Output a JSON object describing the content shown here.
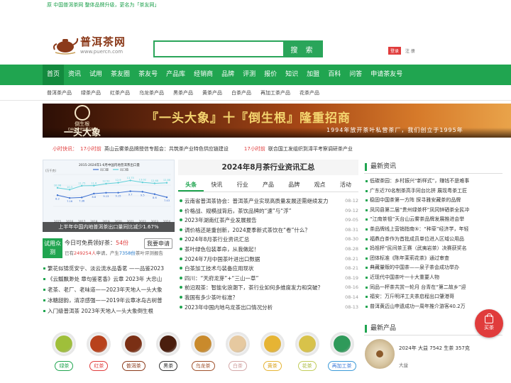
{
  "topbar": {
    "notice": "原 中国普洱茶网 整体品牌升级，更名为「茶友网」"
  },
  "logo": {
    "cn": "普洱茶网",
    "url": "www.puercn.com"
  },
  "search": {
    "placeholder": "",
    "button": "搜 索"
  },
  "user": {
    "login": "登录",
    "register": "注 册"
  },
  "mainnav": [
    "首页",
    "资讯",
    "试用",
    "茶友圈",
    "茶友号",
    "产品库",
    "经销商",
    "品牌",
    "评测",
    "报价",
    "知识",
    "加盟",
    "百科",
    "问答",
    "申请茶友号"
  ],
  "subnav": [
    "普洱茶产品",
    "绿茶产品",
    "红茶产品",
    "乌龙茶产品",
    "黑茶产品",
    "黄茶产品",
    "白茶产品",
    "再加工茶产品",
    "花茶产品"
  ],
  "banner": {
    "brand": "倒生根",
    "brand_en": "DAOSHENGGEN",
    "big": "一头大象",
    "title": "『一头大象』十『倒生根』隆重招商",
    "sub": "1994年放开茶叶私营茶厂，我们创立于1995年"
  },
  "ticker": [
    {
      "label": "小时快讯：",
      "time": "17小时前",
      "text": "英山云雾茶品牌授信专题会：共筑茶产业特色供应链建设"
    },
    {
      "label": "",
      "time": "17小时前",
      "text": "联合国工发组织到漳平考察调研茶产业"
    }
  ],
  "chart_data": {
    "type": "line",
    "title": "2015-2024年1-6月中国内地普洱茶出口量",
    "ylabel": "(万千克)",
    "legend": [
      "出口量",
      "出口值"
    ],
    "categories": [
      "2015",
      "2016",
      "2017",
      "2018",
      "2019",
      "2020",
      "2021",
      "2022",
      "2023",
      "2024"
    ],
    "series": [
      {
        "name": "出口量",
        "values": [
          8.2,
          7.16,
          7.36,
          8.8,
          9.13,
          9.15,
          9.7,
          9.5,
          8.6,
          7.43
        ],
        "color": "#3b6fd1"
      },
      {
        "name": "出口值",
        "values": [
          10.98,
          10.3,
          11.75,
          11.8,
          12.52,
          12.9,
          13.75,
          13.02,
          12.68,
          12.88
        ],
        "color": "#5fd0d8"
      }
    ],
    "ylim": [
      0,
      16
    ],
    "caption": "上半年中国内地普洱茶出口量同比减少1.67%"
  },
  "trial": {
    "tag": "试用众测",
    "line1_prefix": "今日可免费领好茶：",
    "line1_num": "54份",
    "line2_a": "已有",
    "line2_users": "249254人",
    "line2_b": "申请，产生",
    "line2_reports": "7358份",
    "line2_c": "茶叶评测报告",
    "apply": "我要申请"
  },
  "leftlist": [
    "繁花似锦觅安宁、淡云流水品香茗 ——品鉴2023",
    "《云瓢飘渺处 章句鉴茗香》云章 2023年 大忠山",
    "老茶、老厂、老味道——2023年天地人一头大象",
    "冰糖甜韵，清凉感强——2019年云章冰岛古树普",
    "入门级普洱茶 2023年天地人一头大象倒生根"
  ],
  "center": {
    "title": "2024年8月茶行业资讯汇总",
    "tabs": [
      "头条",
      "快讯",
      "行业",
      "产品",
      "品牌",
      "观点",
      "活动"
    ],
    "news": [
      {
        "t": "云南省普洱茶协会：普洱茶产业实现高质量发展还需继续发力",
        "d": "08-12"
      },
      {
        "t": "价格战、规模战背后，茶饮品牌的“速”与“浮”",
        "d": "09-12"
      },
      {
        "t": "2023年湖南红茶产业发展报告",
        "d": "09-05"
      },
      {
        "t": "调价格还是重创新，2024夏季新式茶饮在“卷”什么？",
        "d": "08-31"
      },
      {
        "t": "2024年8月茶行业资讯汇总",
        "d": "08-30"
      },
      {
        "t": "茶叶绿色包装革命，从我做起！",
        "d": "08-28"
      },
      {
        "t": "2024年7月中国茶叶进出口数据",
        "d": "08-21"
      },
      {
        "t": "白茶加工技术与装备应用现状",
        "d": "08-21"
      },
      {
        "t": "四川：“天府龙芽”+“三山一草”",
        "d": "08-19"
      },
      {
        "t": "前沿观茶：智能化浪潮下，茶行业如何多维度发力和突破？",
        "d": "08-16"
      },
      {
        "t": "我国有多少茶叶标准？",
        "d": "08-14"
      },
      {
        "t": "2023年中国内地乌龙茶出口情况分析",
        "d": "08-13"
      }
    ]
  },
  "teas": [
    {
      "name": "绿茶",
      "color": "#9fbf3a",
      "border": "#20a550",
      "text": "#20a550"
    },
    {
      "name": "红茶",
      "color": "#b8421c",
      "border": "#e03c3c",
      "text": "#e03c3c"
    },
    {
      "name": "普洱茶",
      "color": "#7a2f14",
      "border": "#8b3a1a",
      "text": "#8b3a1a"
    },
    {
      "name": "黑茶",
      "color": "#4a1e0e",
      "border": "#333333",
      "text": "#333333"
    },
    {
      "name": "乌龙茶",
      "color": "#c98a2c",
      "border": "#a0522d",
      "text": "#a0522d"
    },
    {
      "name": "白茶",
      "color": "#e6c9a0",
      "border": "#d4a8a8",
      "text": "#c99"
    },
    {
      "name": "黄茶",
      "color": "#e6b434",
      "border": "#e6b434",
      "text": "#d9a21c"
    },
    {
      "name": "花茶",
      "color": "#d8c24a",
      "border": "#c2cc5a",
      "text": "#a9b83a"
    },
    {
      "name": "再加工茶",
      "color": "#2f9a5a",
      "border": "#3c9ad8",
      "text": "#3c7ad8"
    }
  ],
  "right": {
    "head": "最新资讯",
    "news": [
      "低碳茶园：乡村振兴“新样式”，赚钱不是难事",
      "广东近70名制茶高手同台比拼 展现粤茶工匠",
      "稳固中国茶第一方阵 探寻雅安藏茶的品牌",
      "凤冈县第二届“贵州绿茶杯”凤冈锌硒茶全民冲",
      "“江南茶祖”天台山云雾茶品牌发展推进会举",
      "茶品牌线上营销指南⑤：“种草”经济学，年轻",
      "福鼎白茶作为首批成员单位进入区域公用品",
      "妈祖杯“民间茶王赛（武夷岩茶）决赛获奖名",
      "团体标准《陈年茉莉花茶》通过审查",
      "典藏量贩的中国茶——泉子茶会成功举办",
      "近现代中国茶叶一十大重要人物",
      "同品一杯茶共赏一轮月 台青在“第二故乡”迎",
      "福安：万斤明洋工夫茶启程出口肇港哥",
      "普洱黄迈山申遗成功一周年推介游客40.2万"
    ],
    "head2": "最新产品",
    "product": {
      "name": "2024年 大益 7542 生茶 357克",
      "brand": "大益"
    }
  },
  "float": {
    "label": "买茶"
  }
}
